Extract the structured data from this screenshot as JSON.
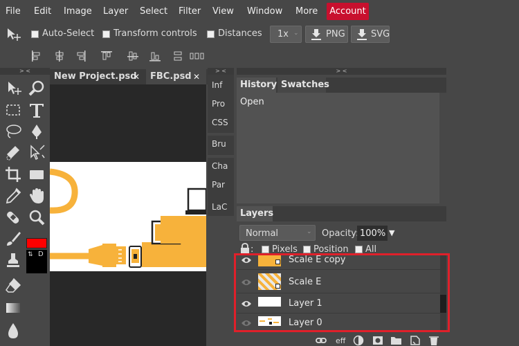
{
  "menu": {
    "items": [
      "File",
      "Edit",
      "Image",
      "Layer",
      "Select",
      "Filter",
      "View",
      "Window",
      "More"
    ],
    "account_label": "Account"
  },
  "options": {
    "auto_select": "Auto-Select",
    "transform_controls": "Transform controls",
    "distances": "Distances",
    "zoom_value": "1x",
    "png_label": "PNG",
    "svg_label": "SVG"
  },
  "collapse_marker": "> <",
  "tabs": [
    {
      "label": "New Project.psd",
      "close": "✕"
    },
    {
      "label": "FBC.psd",
      "close": "✕"
    }
  ],
  "side_panel_tabs": [
    "Inf",
    "Pro",
    "CSS",
    "Bru",
    "Cha",
    "Par",
    "LaC"
  ],
  "history_panel": {
    "tabs": [
      "History",
      "Swatches"
    ],
    "items": [
      "Open"
    ]
  },
  "layers_panel": {
    "title": "Layers",
    "blend_mode": "Normal",
    "opacity_label": "Opacity:",
    "opacity_value": "100%",
    "lock_label": ":",
    "lock_options": [
      "Pixels",
      "Position",
      "All"
    ],
    "layers": [
      {
        "name": "Scale E copy",
        "visible": true
      },
      {
        "name": "Scale E",
        "visible": false
      },
      {
        "name": "Layer 1",
        "visible": true
      },
      {
        "name": "Layer 0",
        "visible": false
      }
    ],
    "footer_eff": "eff"
  },
  "colors": {
    "accent_red": "#c8102e",
    "foreground_color": "#ff0000",
    "background_color": "#000000",
    "highlight_box": "#e0202a",
    "artwork_orange": "#f7b23b"
  }
}
